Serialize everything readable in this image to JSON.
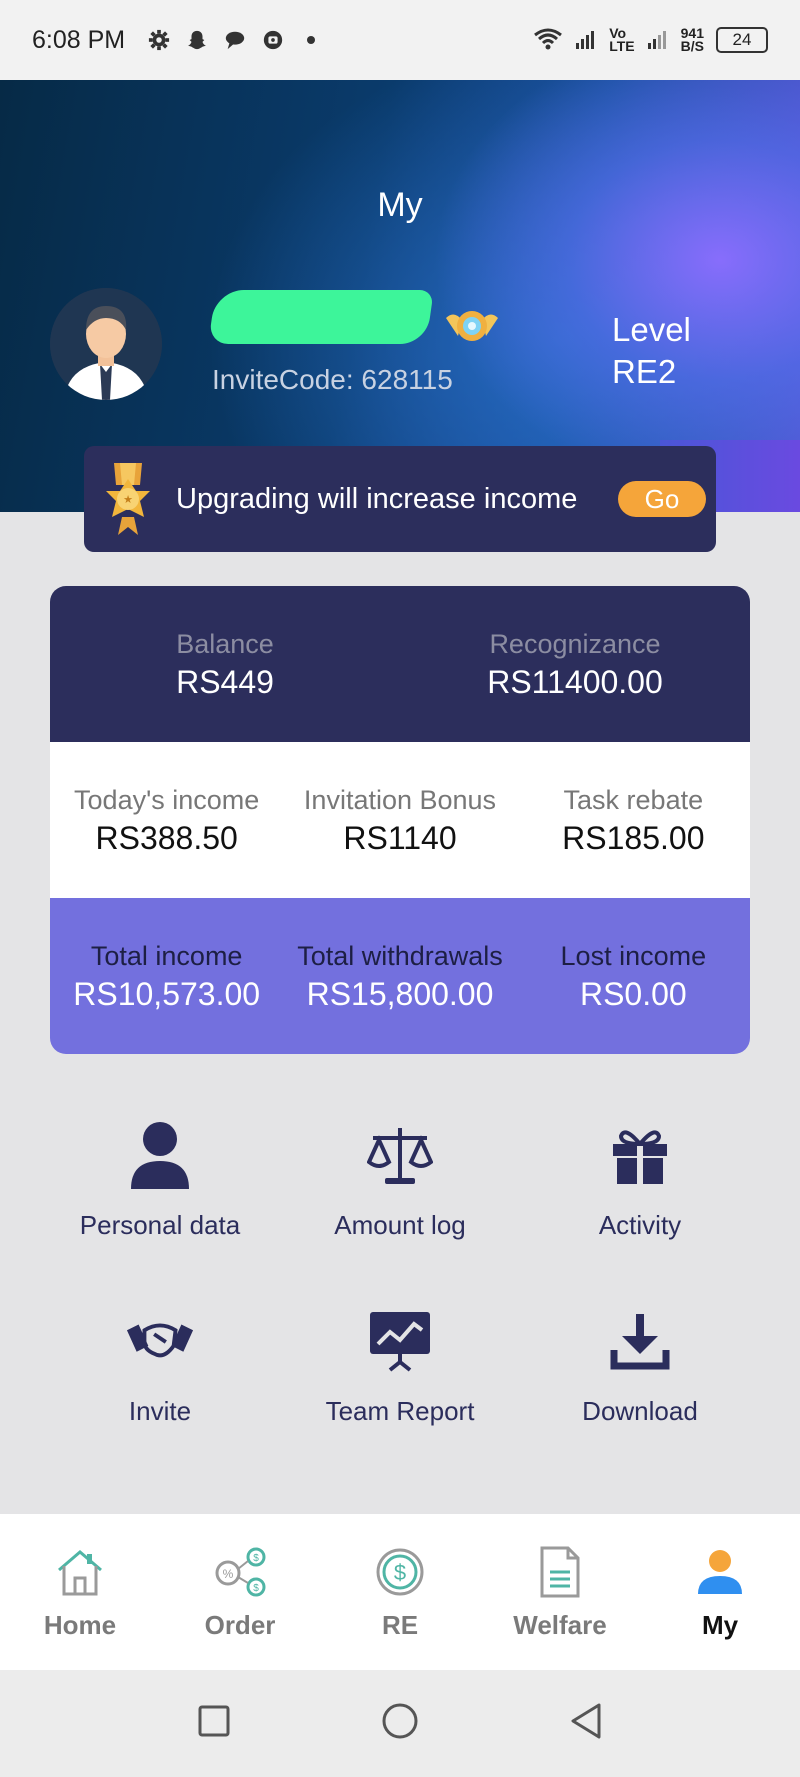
{
  "status_bar": {
    "time": "6:08 PM",
    "net_speed_top": "941",
    "net_speed_bottom": "B/S",
    "lte_top": "Vo",
    "lte_bottom": "LTE",
    "battery": "24"
  },
  "header": {
    "title": "My",
    "invite_code": "InviteCode: 628115",
    "level_label": "Level",
    "level_value": "RE2"
  },
  "upgrade_banner": {
    "text": "Upgrading will increase income",
    "button": "Go"
  },
  "stats": {
    "top": [
      {
        "label": "Balance",
        "value": "RS449"
      },
      {
        "label": "Recognizance",
        "value": "RS11400.00"
      }
    ],
    "middle": [
      {
        "label": "Today's income",
        "value": "RS388.50"
      },
      {
        "label": "Invitation Bonus",
        "value": "RS1140"
      },
      {
        "label": "Task rebate",
        "value": "RS185.00"
      }
    ],
    "bottom": [
      {
        "label": "Total income",
        "value": "RS10,573.00"
      },
      {
        "label": "Total withdrawals",
        "value": "RS15,800.00"
      },
      {
        "label": "Lost income",
        "value": "RS0.00"
      }
    ]
  },
  "menu": [
    {
      "label": "Personal data",
      "icon": "user-icon"
    },
    {
      "label": "Amount log",
      "icon": "scale-icon"
    },
    {
      "label": "Activity",
      "icon": "gift-icon"
    },
    {
      "label": "Invite",
      "icon": "handshake-icon"
    },
    {
      "label": "Team Report",
      "icon": "chart-board-icon"
    },
    {
      "label": "Download",
      "icon": "download-icon"
    }
  ],
  "bottom_nav": [
    {
      "label": "Home",
      "icon": "home-icon"
    },
    {
      "label": "Order",
      "icon": "order-icon"
    },
    {
      "label": "RE",
      "icon": "dollar-icon"
    },
    {
      "label": "Welfare",
      "icon": "document-icon"
    },
    {
      "label": "My",
      "icon": "person-icon",
      "active": true
    }
  ],
  "colors": {
    "primary_dark": "#2c2e5c",
    "accent_purple": "#7370de",
    "go_orange": "#f5a53a",
    "mask_green": "#3df59a"
  }
}
